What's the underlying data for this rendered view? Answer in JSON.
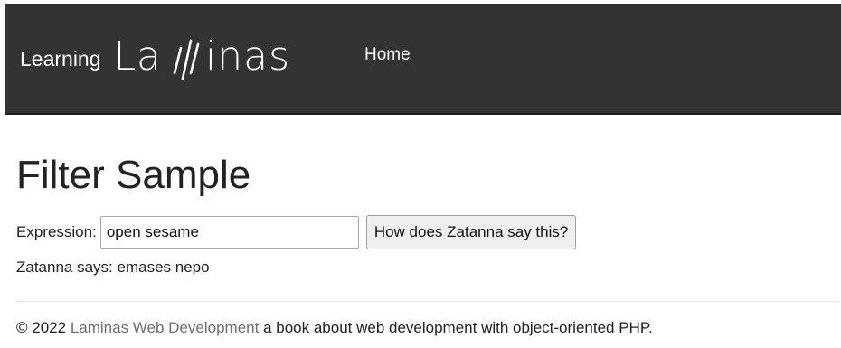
{
  "navbar": {
    "brand_prefix": "Learning",
    "brand_logo_start": "La",
    "brand_logo_end": "inas",
    "home_label": "Home",
    "background_color": "#333333"
  },
  "main": {
    "title": "Filter Sample",
    "form": {
      "expression_label": "Expression:",
      "expression_value": "open sesame",
      "submit_label": "How does Zatanna say this?"
    },
    "result_text": "Zatanna says: emases nepo"
  },
  "footer": {
    "copyright": "© 2022",
    "link_text": "Laminas Web Development",
    "tagline": "a book about web development with object-oriented PHP."
  }
}
